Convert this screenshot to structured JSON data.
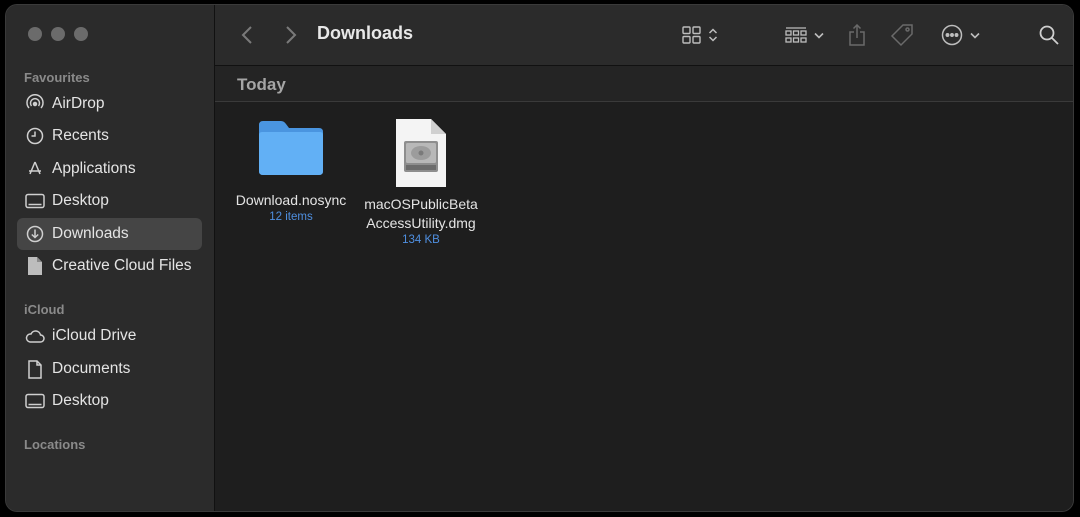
{
  "window": {
    "title": "Downloads"
  },
  "sidebar": {
    "sections": [
      {
        "title": "Favourites",
        "items": [
          {
            "label": "AirDrop",
            "icon": "airdrop-icon"
          },
          {
            "label": "Recents",
            "icon": "clock-icon"
          },
          {
            "label": "Applications",
            "icon": "applications-icon"
          },
          {
            "label": "Desktop",
            "icon": "desktop-icon"
          },
          {
            "label": "Downloads",
            "icon": "download-circle-icon",
            "selected": true
          },
          {
            "label": "Creative Cloud Files",
            "icon": "document-icon"
          }
        ]
      },
      {
        "title": "iCloud",
        "items": [
          {
            "label": "iCloud Drive",
            "icon": "cloud-icon"
          },
          {
            "label": "Documents",
            "icon": "document-icon"
          },
          {
            "label": "Desktop",
            "icon": "desktop-icon"
          }
        ]
      },
      {
        "title": "Locations",
        "items": []
      }
    ]
  },
  "content": {
    "group_title": "Today",
    "files": [
      {
        "name": "Download.nosync",
        "meta": "12 items",
        "kind": "folder"
      },
      {
        "name_line1": "macOSPublicBeta",
        "name_line2": "AccessUtility.dmg",
        "meta": "134 KB",
        "kind": "dmg"
      }
    ]
  },
  "colors": {
    "accent": "#4f8fe0",
    "folder": "#5aa9f0",
    "selected": "#454545"
  }
}
